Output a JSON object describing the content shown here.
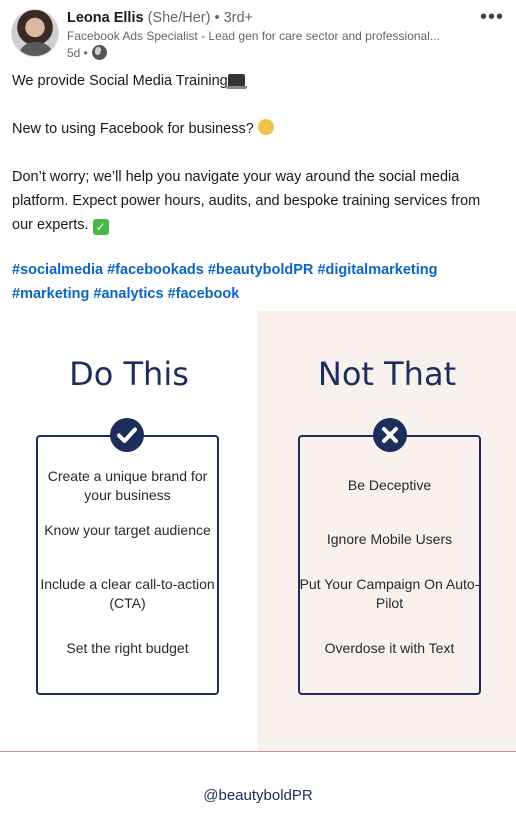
{
  "post": {
    "author_name": "Leona Ellis",
    "pronouns": "(She/Her)",
    "degree": "• 3rd+",
    "headline": "Facebook Ads Specialist - Lead gen for care sector and professional...",
    "time": "5d •",
    "more_label": "•••",
    "paragraph1": "We provide Social Media Training",
    "paragraph2": "New to using Facebook for business?",
    "paragraph3": "Don’t worry; we’ll help you navigate your way around the social media platform. Expect power hours, audits, and bespoke training services from our experts.",
    "hashtags_line1": [
      "#socialmedia",
      "#facebookads",
      "#beautyboldPR",
      "#digitalmarketing"
    ],
    "hashtags_line2": [
      "#marketing",
      "#analytics",
      "#facebook"
    ]
  },
  "graphic": {
    "left_title": "Do This",
    "right_title": "Not That",
    "left_items": [
      "Create a unique brand for your business",
      "Know your target audience",
      "Include a clear call-to-action (CTA)",
      "Set the right budget"
    ],
    "right_items": [
      "Be Deceptive",
      "Ignore Mobile Users",
      "Put Your Campaign On Auto-Pilot",
      "Overdose it with Text"
    ],
    "handle": "@beautyboldPR"
  },
  "colors": {
    "navy": "#1d2d5c",
    "link_blue": "#0a66c2",
    "right_panel_bg": "#f8f1ed"
  },
  "icons": [
    "globe-icon",
    "more-options-icon",
    "checkmark-circle-icon",
    "x-circle-icon",
    "laptop-emoji",
    "shrug-emoji",
    "check-mark-emoji"
  ]
}
